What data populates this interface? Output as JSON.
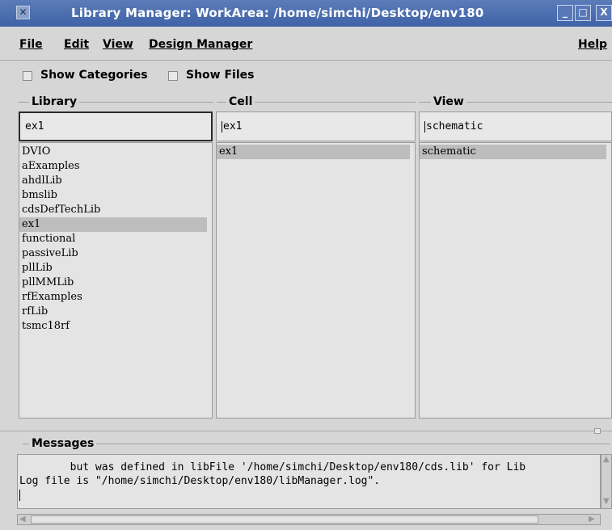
{
  "window": {
    "title": "Library Manager: WorkArea: /home/simchi/Desktop/env180",
    "controls": {
      "minimize": "_",
      "maximize": "□",
      "close": "X"
    },
    "app_icon": "x-icon"
  },
  "menubar": {
    "file": "File",
    "edit": "Edit",
    "view": "View",
    "design_manager": "Design Manager",
    "help": "Help"
  },
  "options": {
    "show_categories": {
      "label": "Show Categories",
      "checked": false
    },
    "show_files": {
      "label": "Show Files",
      "checked": false
    }
  },
  "library": {
    "header": "Library",
    "value": "ex1",
    "items": [
      "DVIO",
      "aExamples",
      "ahdlLib",
      "bmslib",
      "cdsDefTechLib",
      "ex1",
      "functional",
      "passiveLib",
      "pllLib",
      "pllMMLib",
      "rfExamples",
      "rfLib",
      "tsmc18rf"
    ],
    "selected": "ex1"
  },
  "cell": {
    "header": "Cell",
    "value": "ex1",
    "items": [
      "ex1"
    ],
    "selected": "ex1"
  },
  "view": {
    "header": "View",
    "value": "schematic",
    "items": [
      "schematic"
    ],
    "selected": "schematic"
  },
  "messages": {
    "header": "Messages",
    "lines": [
      "        but was defined in libFile '/home/simchi/Desktop/env180/cds.lib' for Lib",
      "Log file is \"/home/simchi/Desktop/env180/libManager.log\"."
    ]
  },
  "colors": {
    "titlebar": "#3f62a8",
    "background": "#d6d6d6",
    "selection": "#bdbdbd"
  }
}
